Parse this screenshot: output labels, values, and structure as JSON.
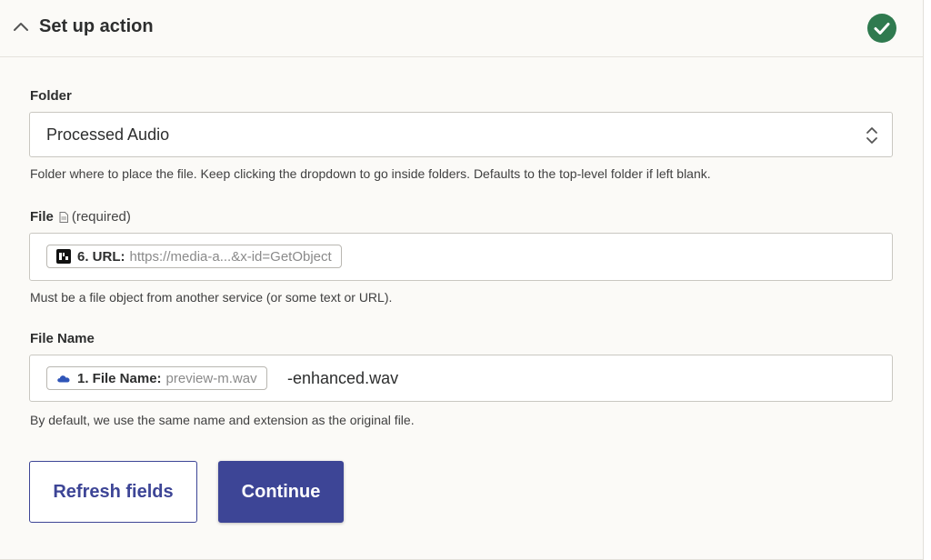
{
  "section": {
    "title": "Set up action",
    "status_color": "#2f7a4f"
  },
  "folder": {
    "label": "Folder",
    "value": "Processed Audio",
    "help": "Folder where to place the file. Keep clicking the dropdown to go inside folders. Defaults to the top-level folder if left blank."
  },
  "file": {
    "label": "File",
    "required": "(required)",
    "pill_label": "6. URL:",
    "pill_value": "https://media-a...&x-id=GetObject",
    "pill_icon": "dark-app-icon",
    "help": "Must be a file object from another service (or some text or URL)."
  },
  "file_name": {
    "label": "File Name",
    "pill_label": "1. File Name:",
    "pill_value": "preview-m.wav",
    "pill_icon": "cloud-icon",
    "suffix": "-enhanced.wav",
    "help": "By default, we use the same name and extension as the original file."
  },
  "buttons": {
    "refresh": "Refresh fields",
    "continue": "Continue"
  },
  "colors": {
    "primary": "#3d4596",
    "success": "#2f7a4f"
  }
}
